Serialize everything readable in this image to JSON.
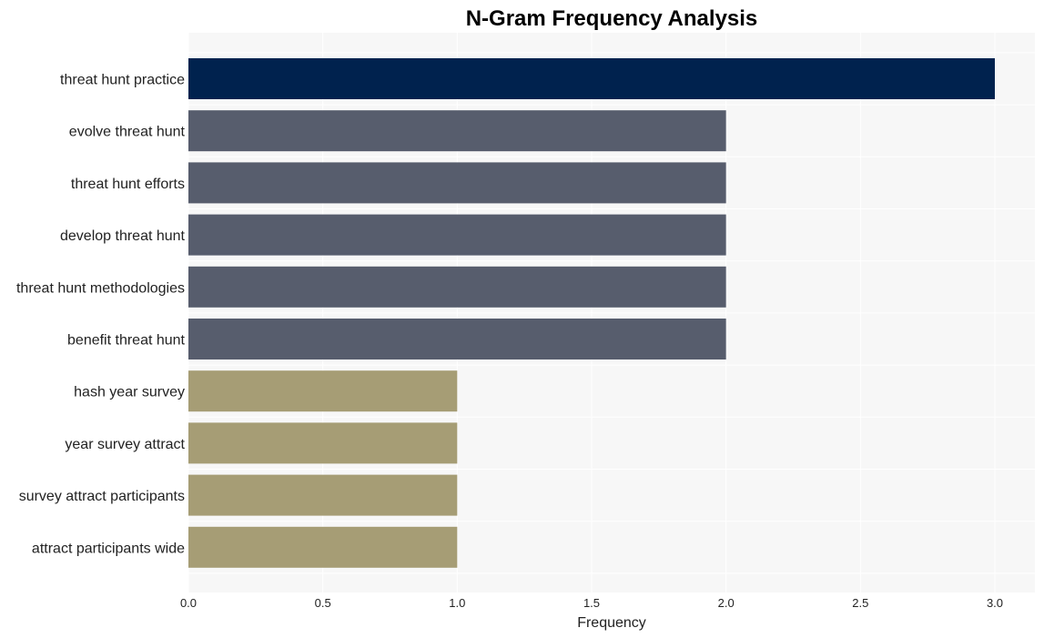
{
  "chart_data": {
    "type": "bar",
    "orientation": "horizontal",
    "title": "N-Gram Frequency Analysis",
    "xlabel": "Frequency",
    "ylabel": "",
    "xlim": [
      0,
      3.15
    ],
    "xticks": [
      "0.0",
      "0.5",
      "1.0",
      "1.5",
      "2.0",
      "2.5",
      "3.0"
    ],
    "xtick_values": [
      0,
      0.5,
      1.0,
      1.5,
      2.0,
      2.5,
      3.0
    ],
    "grid": true,
    "categories": [
      "threat hunt practice",
      "evolve threat hunt",
      "threat hunt efforts",
      "develop threat hunt",
      "threat hunt methodologies",
      "benefit threat hunt",
      "hash year survey",
      "year survey attract",
      "survey attract participants",
      "attract participants wide"
    ],
    "values": [
      3,
      2,
      2,
      2,
      2,
      2,
      1,
      1,
      1,
      1
    ],
    "colors": [
      "#00224e",
      "#575d6d",
      "#575d6d",
      "#575d6d",
      "#575d6d",
      "#575d6d",
      "#a69d75",
      "#a69d75",
      "#a69d75",
      "#a69d75"
    ],
    "background": "#f7f7f7"
  }
}
